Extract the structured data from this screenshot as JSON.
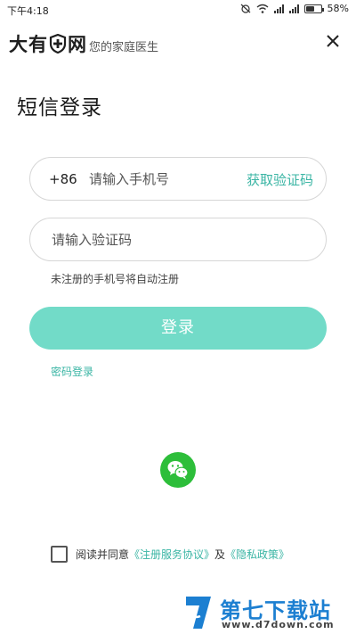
{
  "status_bar": {
    "time": "下午4:18",
    "battery": "58%",
    "battery_level": 0.58
  },
  "header": {
    "logo_left": "大有",
    "logo_right": "网",
    "slogan": "您的家庭医生"
  },
  "page_title": "短信登录",
  "phone_field": {
    "country_code": "+86",
    "placeholder": "请输入手机号",
    "value": "",
    "get_code_label": "获取验证码"
  },
  "code_field": {
    "placeholder": "请输入验证码",
    "value": ""
  },
  "auto_register_tip": "未注册的手机号将自动注册",
  "login_button": "登录",
  "password_login_link": "密码登录",
  "agreement": {
    "prefix": "阅读并同意",
    "terms_link": "《注册服务协议》",
    "conjunction": "及",
    "privacy_link": "《隐私政策》",
    "checked": false
  },
  "watermark": {
    "name": "第七下载站",
    "url": "www.d7down.com"
  },
  "colors": {
    "accent": "#3ab5a4",
    "login_button_bg": "#72dbc8",
    "wechat_green": "#2dbe3a",
    "watermark_blue": "#1c7fd1"
  },
  "icons": {
    "logo_mark": "shield-cross-icon",
    "close": "close-icon",
    "wechat": "wechat-icon",
    "checkbox": "checkbox-unchecked-icon"
  }
}
